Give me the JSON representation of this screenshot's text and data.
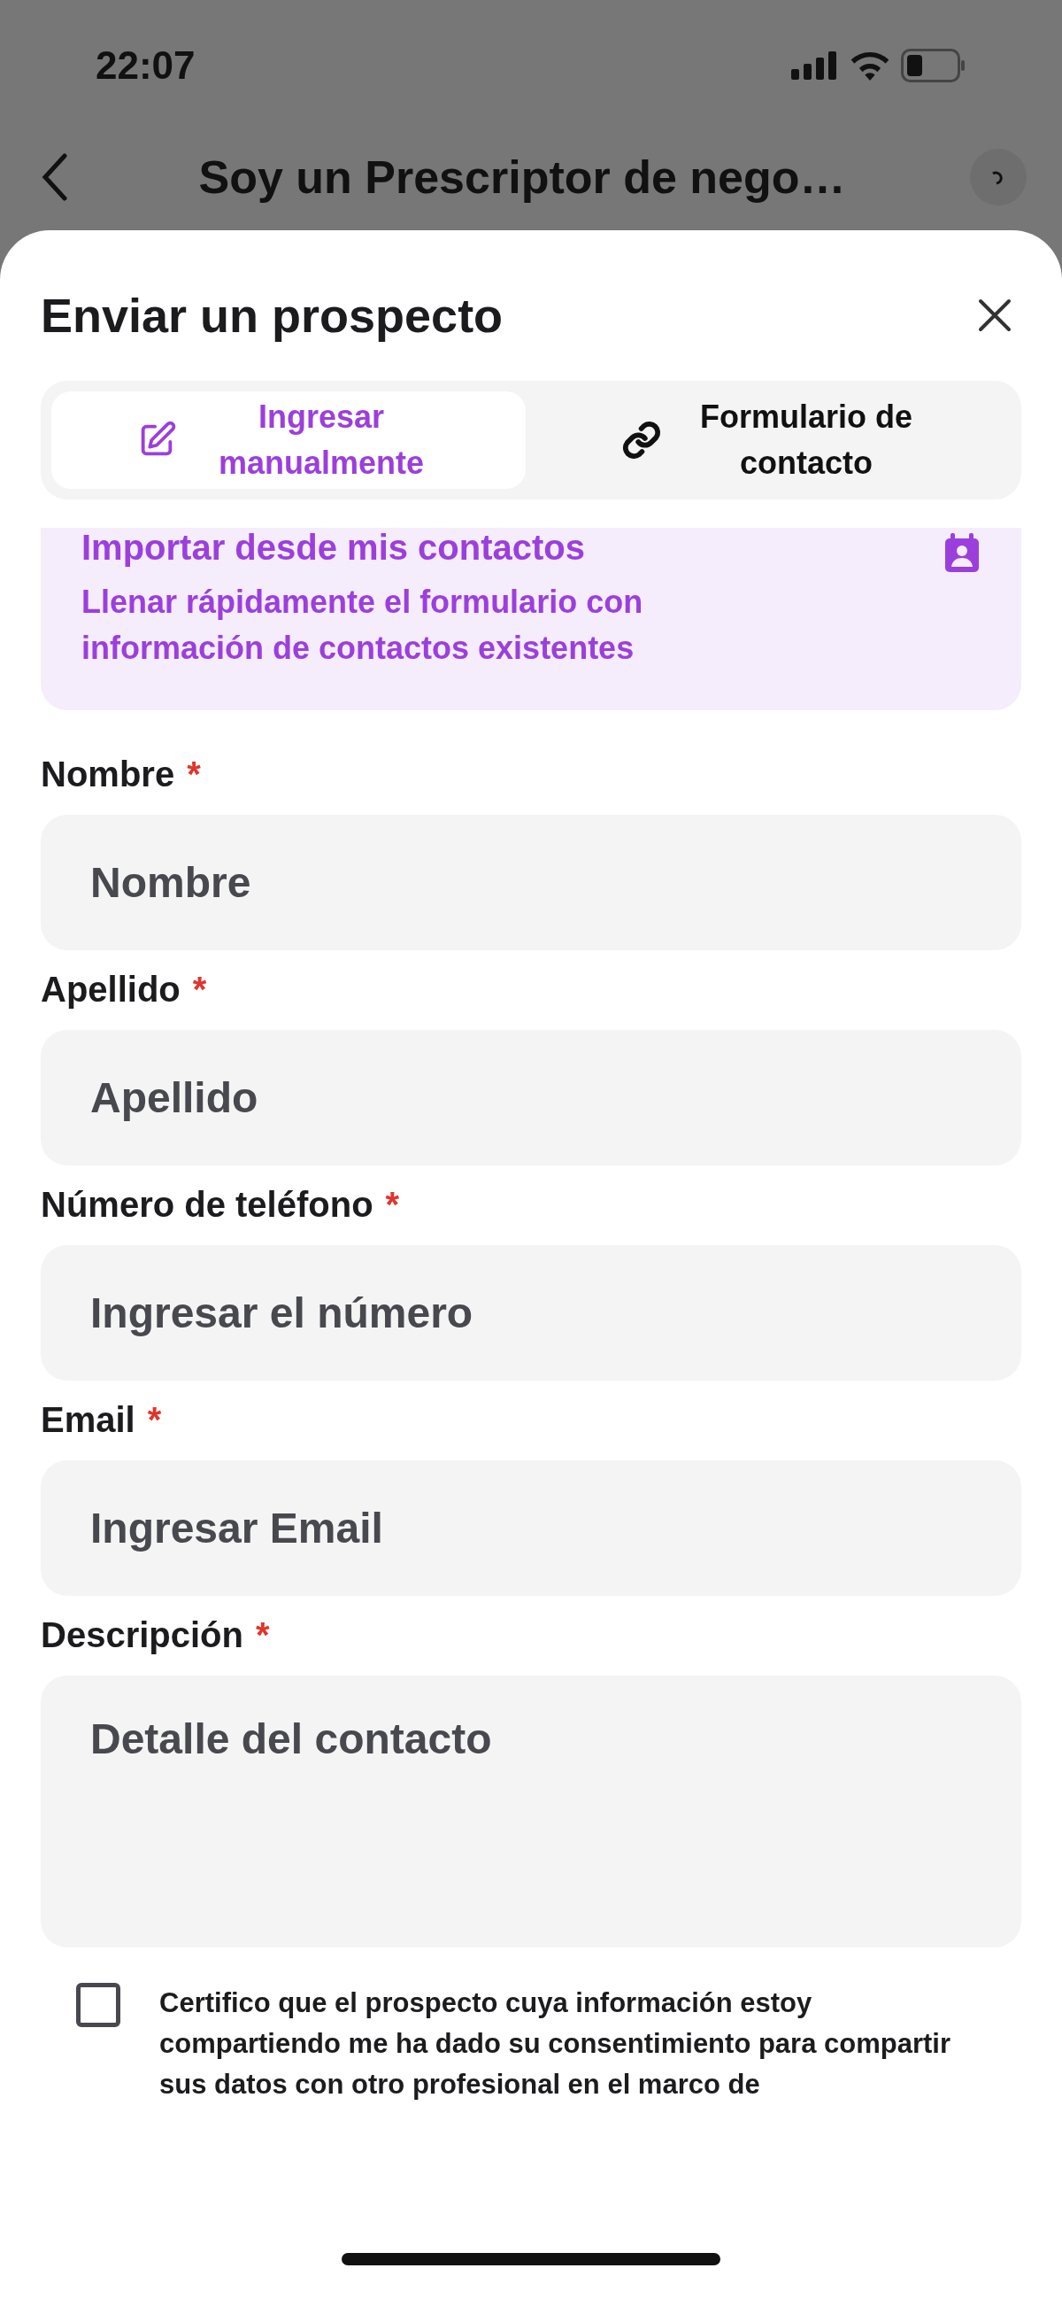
{
  "status_bar": {
    "time": "22:07"
  },
  "header": {
    "title": "Soy un Prescriptor de nego…"
  },
  "sheet": {
    "title": "Enviar un prospecto"
  },
  "tabs": [
    {
      "label": "Ingresar manualmente",
      "kind": "edit",
      "selected": true
    },
    {
      "label": "Formulario de contacto",
      "kind": "link",
      "selected": false
    }
  ],
  "import_card": {
    "title": "Importar desde mis contactos",
    "description": "Llenar rápidamente el formulario con información de contactos existentes"
  },
  "fields": [
    {
      "label": "Nombre",
      "required_mark": "*",
      "placeholder": "Nombre",
      "kind": "input"
    },
    {
      "label": "Apellido",
      "required_mark": "*",
      "placeholder": "Apellido",
      "kind": "input"
    },
    {
      "label": "Número de teléfono",
      "required_mark": "*",
      "placeholder": "Ingresar el número",
      "kind": "input"
    },
    {
      "label": "Email",
      "required_mark": "*",
      "placeholder": "Ingresar Email",
      "kind": "input"
    },
    {
      "label": "Descripción",
      "required_mark": "*",
      "placeholder": "Detalle del contacto",
      "kind": "textarea"
    }
  ],
  "consent": {
    "checked": false,
    "text": "Certifico que el prospecto cuya información estoy compartiendo me ha dado su consentimiento para compartir sus datos con otro profesional en el marco de"
  }
}
